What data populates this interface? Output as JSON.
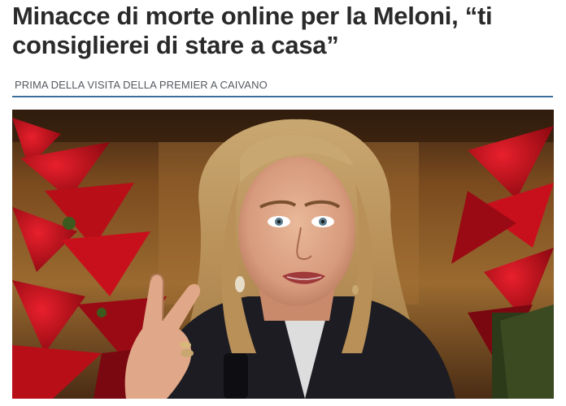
{
  "article": {
    "headline": "Minacce di morte online per la Meloni, “ti consiglierei di stare a casa”",
    "kicker": "PRIMA DELLA VISITA DELLA PREMIER A CAIVANO"
  },
  "colors": {
    "headline_text": "#2a2a2a",
    "kicker_text": "#555a60",
    "rule_accent": "#3d6f9c",
    "poinsettia_red": "#c8101c"
  },
  "photo": {
    "subject": "woman-speaking-gesturing",
    "decor": "poinsettia-plants"
  }
}
